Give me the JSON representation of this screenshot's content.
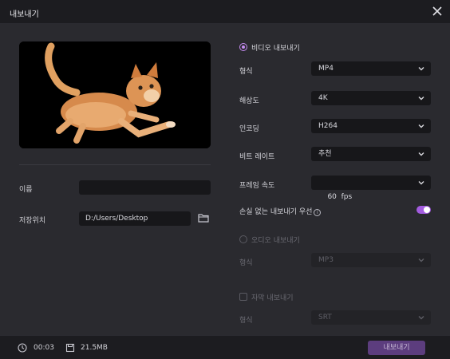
{
  "window": {
    "title": "내보내기"
  },
  "left": {
    "name_label": "이름",
    "name_value": "",
    "save_label": "저장위치",
    "save_path": "D:/Users/Desktop"
  },
  "right": {
    "video_export_label": "비디오 내보내기",
    "rows": [
      {
        "label": "형식",
        "value": "MP4"
      },
      {
        "label": "해상도",
        "value": "4K"
      },
      {
        "label": "인코딩",
        "value": "H264"
      },
      {
        "label": "비트 레이트",
        "value": "추천"
      },
      {
        "label": "프레임 속도",
        "value": "60  fps"
      }
    ],
    "lossless_label": "손실 없는 내보내기 우선",
    "lossless_on": true,
    "audio_export_label": "오디오 내보내기",
    "audio_format_label": "형식",
    "audio_format_value": "MP3",
    "subtitle_export_label": "자막 내보내기",
    "subtitle_format_label": "형식",
    "subtitle_format_value": "SRT"
  },
  "footer": {
    "duration": "00:03",
    "size": "21.5MB",
    "export_button": "내보내기"
  },
  "colors": {
    "accent": "#a35ce0",
    "panel": "#2a2a2f",
    "field": "#17171a"
  }
}
